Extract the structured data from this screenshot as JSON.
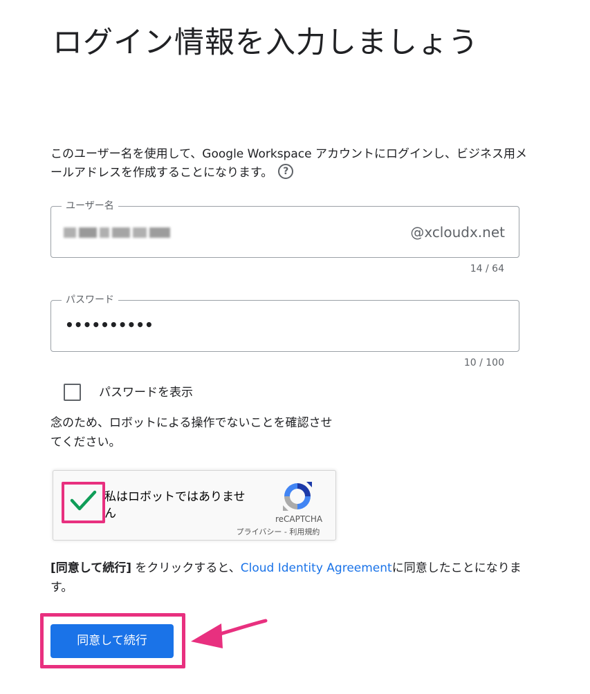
{
  "header": {
    "title": "ログイン情報を入力しましょう"
  },
  "description": {
    "text": "このユーザー名を使用して、Google Workspace アカウントにログインし、ビジネス用メールアドレスを作成することになります。",
    "help_icon": "help-circle-icon",
    "help_glyph": "?"
  },
  "username": {
    "label": "ユーザー名",
    "value_redacted": true,
    "domain_suffix": "@xcloudx.net",
    "counter": "14 / 64"
  },
  "password": {
    "label": "パスワード",
    "value_masked": "••••••••••",
    "counter": "10 / 100"
  },
  "show_password": {
    "label": "パスワードを表示",
    "checked": false
  },
  "robot_note": {
    "text": "念のため、ロボットによる操作でないことを確認させてください。"
  },
  "recaptcha": {
    "label": "私はロボットではありません",
    "checked": true,
    "brand": "reCAPTCHA",
    "links": "プライバシー - 利用規約"
  },
  "agreement": {
    "prefix_bold": "[同意して続行]",
    "middle": " をクリックすると、",
    "link": "Cloud Identity Agreement",
    "suffix": "に同意したことになります。"
  },
  "actions": {
    "continue_label": "同意して続行"
  },
  "colors": {
    "accent": "#1a73e8",
    "highlight": "#e8307f",
    "check": "#109d58"
  }
}
